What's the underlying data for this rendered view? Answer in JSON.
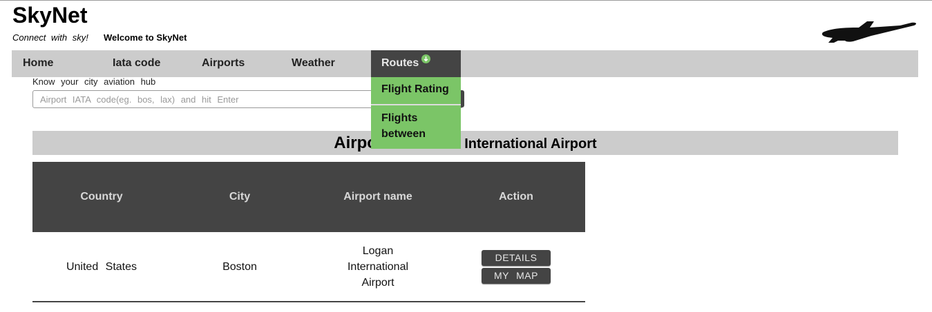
{
  "header": {
    "brand": "SkyNet",
    "tagline": "Connect with sky!",
    "welcome": "Welcome to SkyNet",
    "logo_icon": "airplane-icon"
  },
  "nav": {
    "items": [
      "Home",
      "Iata code",
      "Airports",
      "Weather",
      "Routes"
    ],
    "routes_icon": "arrow-down-circle-icon",
    "dropdown": [
      "Flight Rating",
      "Flights between"
    ]
  },
  "search": {
    "label": "Know your city aviation hub",
    "placeholder": "Airport IATA code(eg. bos, lax) and hit Enter"
  },
  "results": {
    "title_visible_prefix": "Airport",
    "title_visible_suffix": "an International Airport",
    "columns": [
      "Country",
      "City",
      "Airport name",
      "Action"
    ],
    "rows": [
      {
        "country": "United States",
        "city": "Boston",
        "airport_name": "Logan International Airport",
        "actions": [
          "DETAILS",
          "MY MAP"
        ]
      }
    ]
  },
  "colors": {
    "nav_bg": "#cccccc",
    "nav_active": "#444444",
    "dropdown_bg": "#7bc567",
    "table_header": "#444444"
  }
}
